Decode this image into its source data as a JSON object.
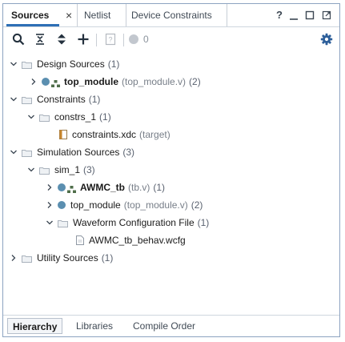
{
  "tabs": [
    {
      "label": "Sources",
      "active": true
    },
    {
      "label": "Netlist",
      "active": false
    },
    {
      "label": "Device Constraints",
      "active": false
    }
  ],
  "window_controls": {
    "help": "?",
    "minimize": "—",
    "restore": "□",
    "float": "⧉"
  },
  "toolbar": {
    "badge_count": "0"
  },
  "tree": {
    "design_sources": {
      "label": "Design Sources",
      "count": "(1)"
    },
    "top_module": {
      "label": "top_module",
      "file": "(top_module.v)",
      "count": "(2)"
    },
    "constraints": {
      "label": "Constraints",
      "count": "(1)"
    },
    "constrs_1": {
      "label": "constrs_1",
      "count": "(1)"
    },
    "constraints_xdc": {
      "label": "constraints.xdc",
      "note": "(target)"
    },
    "simulation_sources": {
      "label": "Simulation Sources",
      "count": "(3)"
    },
    "sim_1": {
      "label": "sim_1",
      "count": "(3)"
    },
    "awmc_tb": {
      "label": "AWMC_tb",
      "file": "(tb.v)",
      "count": "(1)"
    },
    "sim_top_module": {
      "label": "top_module",
      "file": "(top_module.v)",
      "count": "(2)"
    },
    "waveform_cfg": {
      "label": "Waveform Configuration File",
      "count": "(1)"
    },
    "wcfg_file": {
      "label": "AWMC_tb_behav.wcfg"
    },
    "utility_sources": {
      "label": "Utility Sources",
      "count": "(1)"
    }
  },
  "bottom_tabs": [
    {
      "label": "Hierarchy",
      "active": true
    },
    {
      "label": "Libraries",
      "active": false
    },
    {
      "label": "Compile Order",
      "active": false
    }
  ],
  "colors": {
    "accent": "#2e6fb6",
    "module_dot": "#5b8fb0",
    "frame": "#8da3c1"
  }
}
